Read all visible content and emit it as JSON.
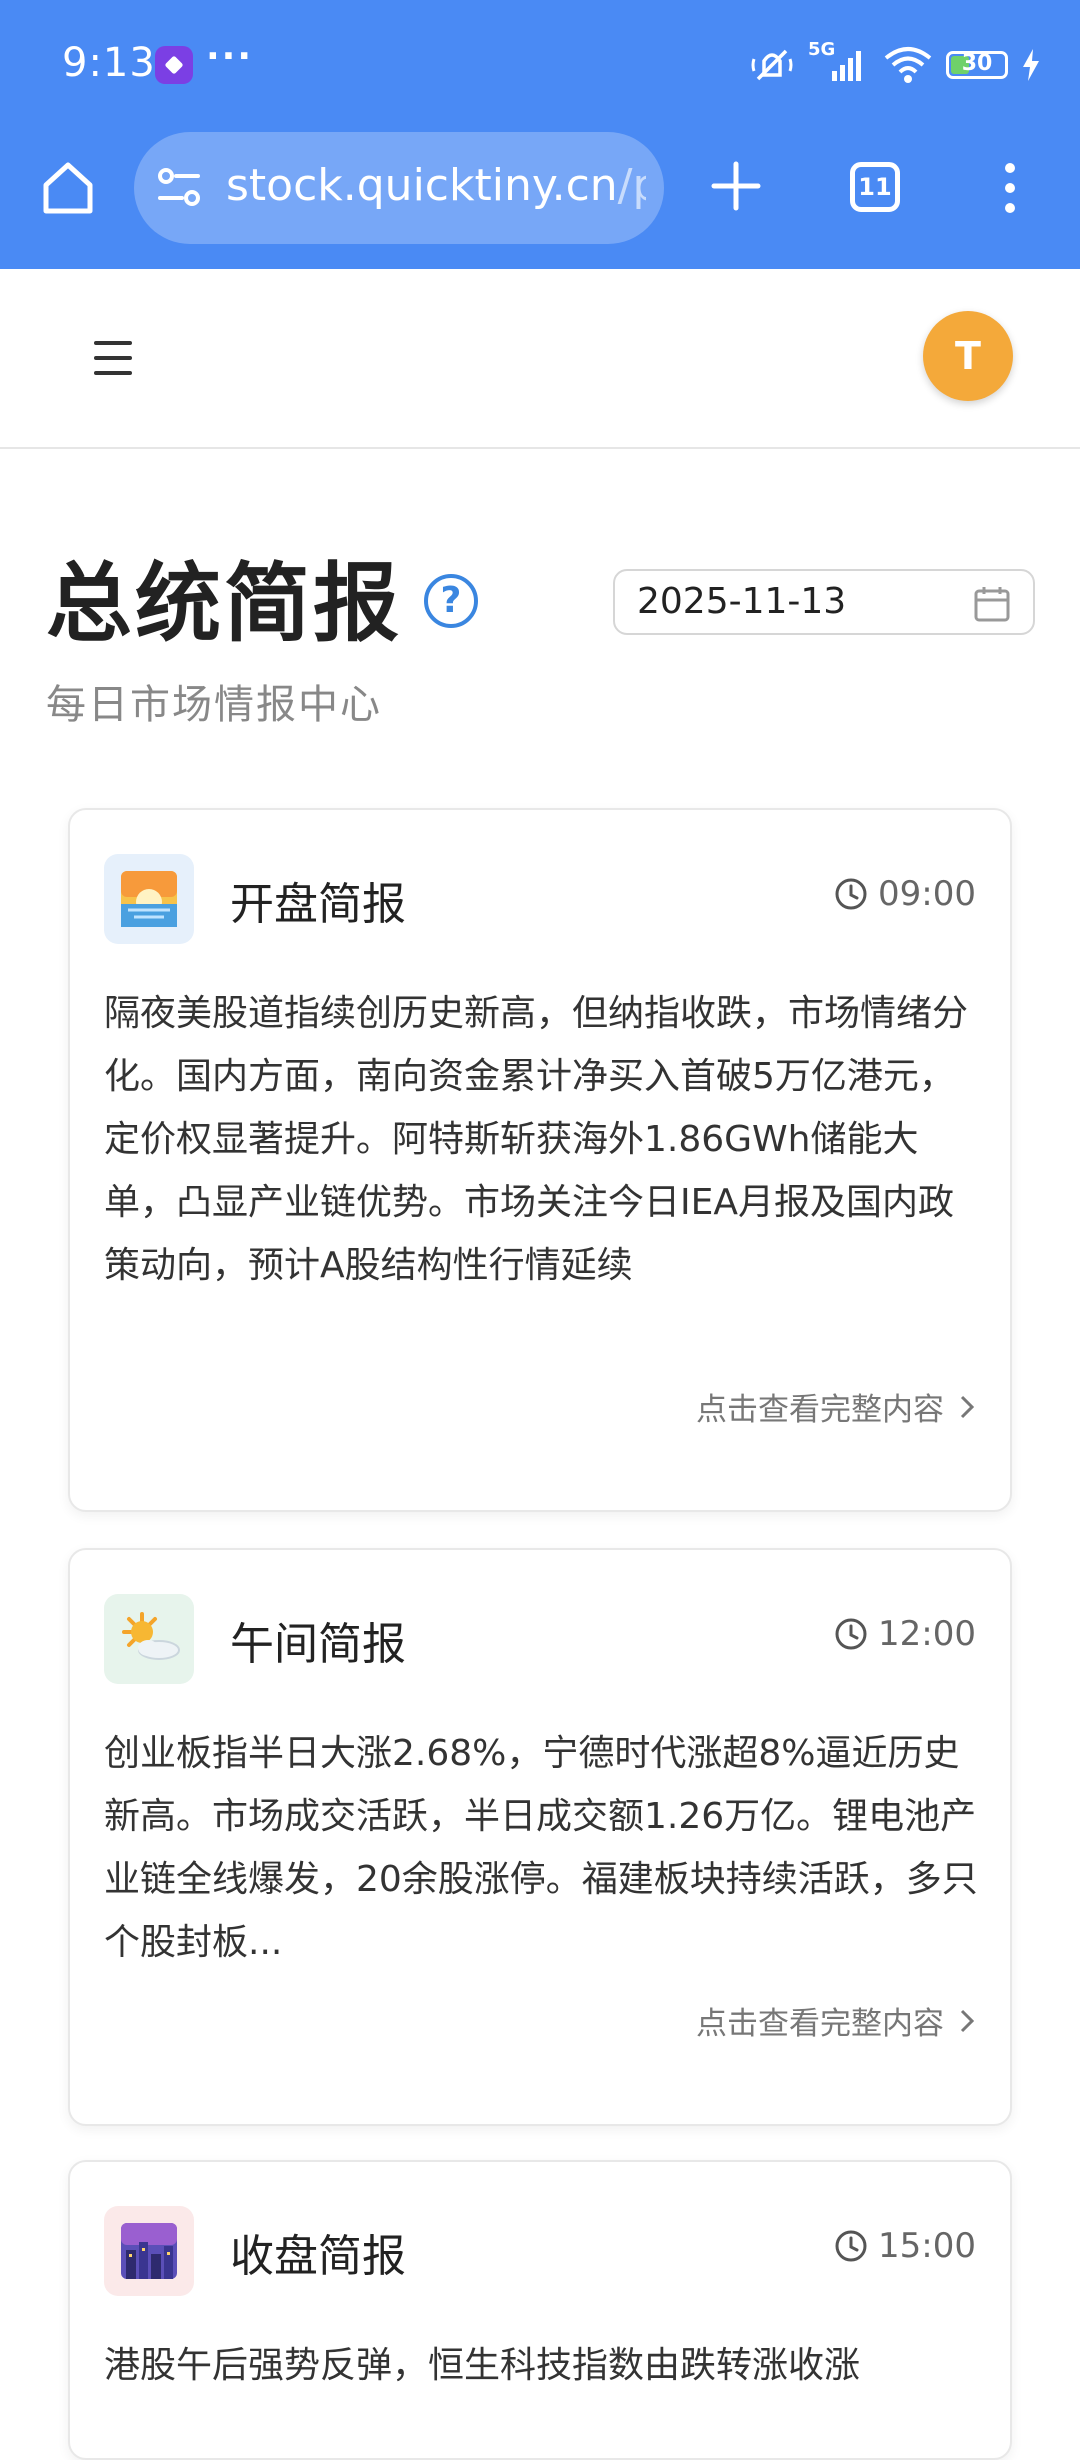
{
  "status_bar": {
    "time": "9:13",
    "more": "···",
    "network": "5G",
    "battery": "30"
  },
  "browser": {
    "url_main": "stock.quicktiny.cn",
    "url_rest": "/pr",
    "tab_count": "11"
  },
  "header": {
    "avatar_letter": "T"
  },
  "page": {
    "title": "总统简报",
    "help": "?",
    "date": "2025-11-13",
    "subtitle": "每日市场情报中心"
  },
  "cards": [
    {
      "title": "开盘简报",
      "time": "09:00",
      "icon": "sunrise-icon",
      "body": "隔夜美股道指续创历史新高，但纳指收跌，市场情绪分化。国内方面，南向资金累计净买入首破5万亿港元，定价权显著提升。阿特斯斩获海外1.86GWh储能大单，凸显产业链优势。市场关注今日IEA月报及国内政策动向，预计A股结构性行情延续",
      "link": "点击查看完整内容"
    },
    {
      "title": "午间简报",
      "time": "12:00",
      "icon": "sun-cloud-icon",
      "body": "创业板指半日大涨2.68%，宁德时代涨超8%逼近历史新高。市场成交活跃，半日成交额1.26万亿。锂电池产业链全线爆发，20余股涨停。福建板块持续活跃，多只个股封板...",
      "link": "点击查看完整内容"
    },
    {
      "title": "收盘简报",
      "time": "15:00",
      "icon": "city-night-icon",
      "body": "港股午后强势反弹，恒生科技指数由跌转涨收涨",
      "link": ""
    }
  ],
  "colors": {
    "chrome": "#4a8af4",
    "avatar": "#f4a93a",
    "help": "#3a86e0"
  }
}
